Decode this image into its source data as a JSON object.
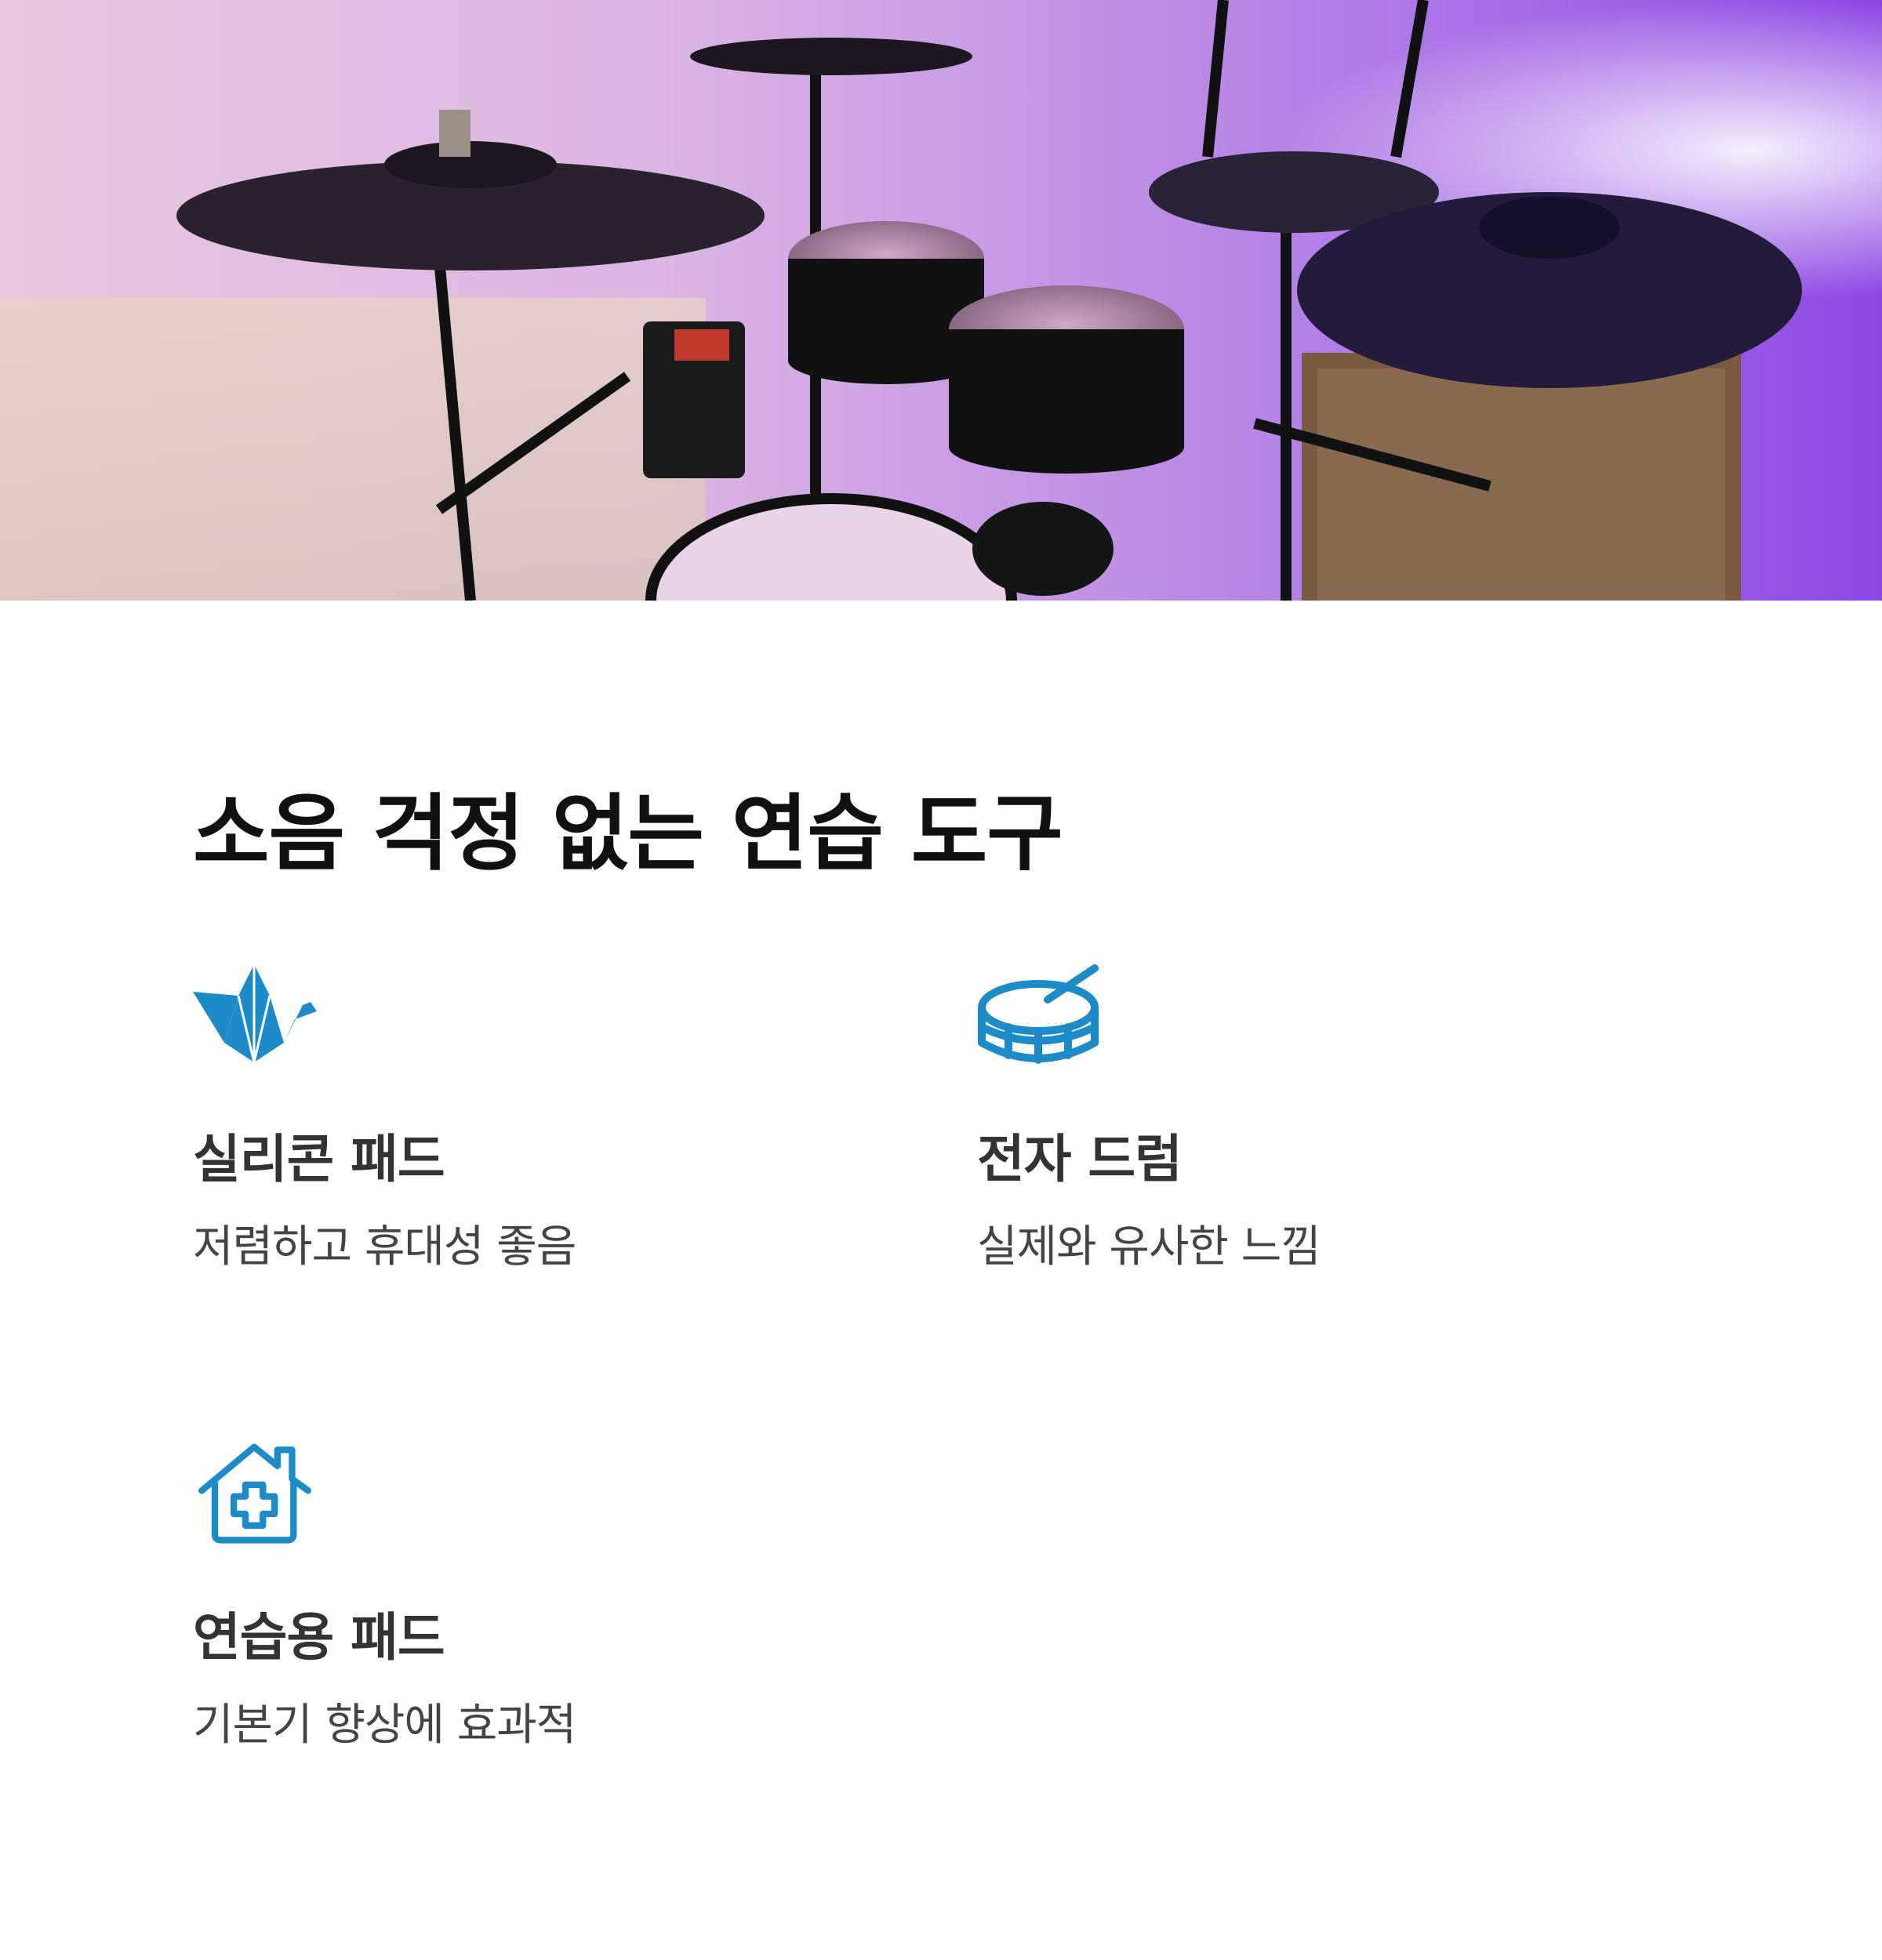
{
  "hero": {
    "image": "drum-kit-photo"
  },
  "section": {
    "title": "소음 걱정 없는 연습 도구"
  },
  "features": [
    {
      "icon": "origami-crane-icon",
      "title": "실리콘 패드",
      "description": "저렴하고 휴대성 좋음"
    },
    {
      "icon": "snare-drum-icon",
      "title": "전자 드럼",
      "description": "실제와 유사한 느낌"
    },
    {
      "icon": "house-plus-icon",
      "title": "연습용 패드",
      "description": "기본기 향상에 효과적"
    }
  ],
  "colors": {
    "accent": "#1E8BC9",
    "title": "#111111",
    "feature_title": "#333333",
    "description": "#444444"
  }
}
